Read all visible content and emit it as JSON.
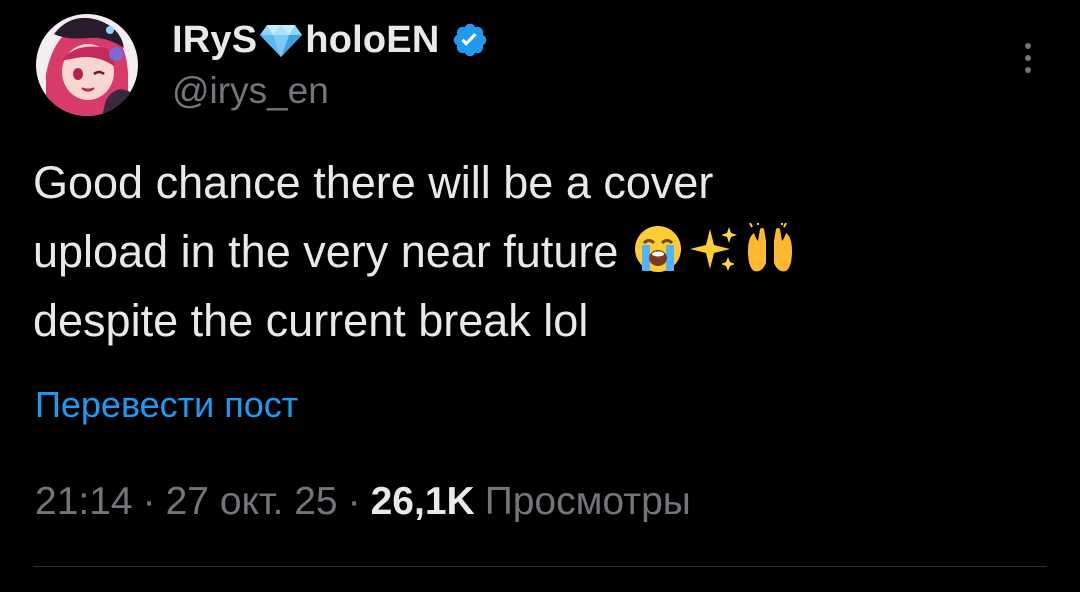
{
  "tweet": {
    "author": {
      "name_part1": "IRyS",
      "name_part2": "holoEN",
      "gem_emoji": "gem-icon",
      "verified": true,
      "handle": "@irys_en"
    },
    "text_lines": [
      "Good chance there will be a cover",
      "upload in the very near future",
      "despite the current break lol"
    ],
    "emojis": [
      "loudly-crying-face-icon",
      "sparkles-icon",
      "raising-hands-icon"
    ],
    "translate_label": "Перевести пост",
    "time": "21:14",
    "date": "27 окт. 25",
    "separator": "·",
    "views_count": "26,1K",
    "views_label": "Просмотры"
  },
  "colors": {
    "background": "#000000",
    "text_primary": "#e7e9ea",
    "text_secondary": "#71767b",
    "link": "#1d9bf0",
    "verified": "#1d9bf0",
    "divider": "#2f3336"
  }
}
